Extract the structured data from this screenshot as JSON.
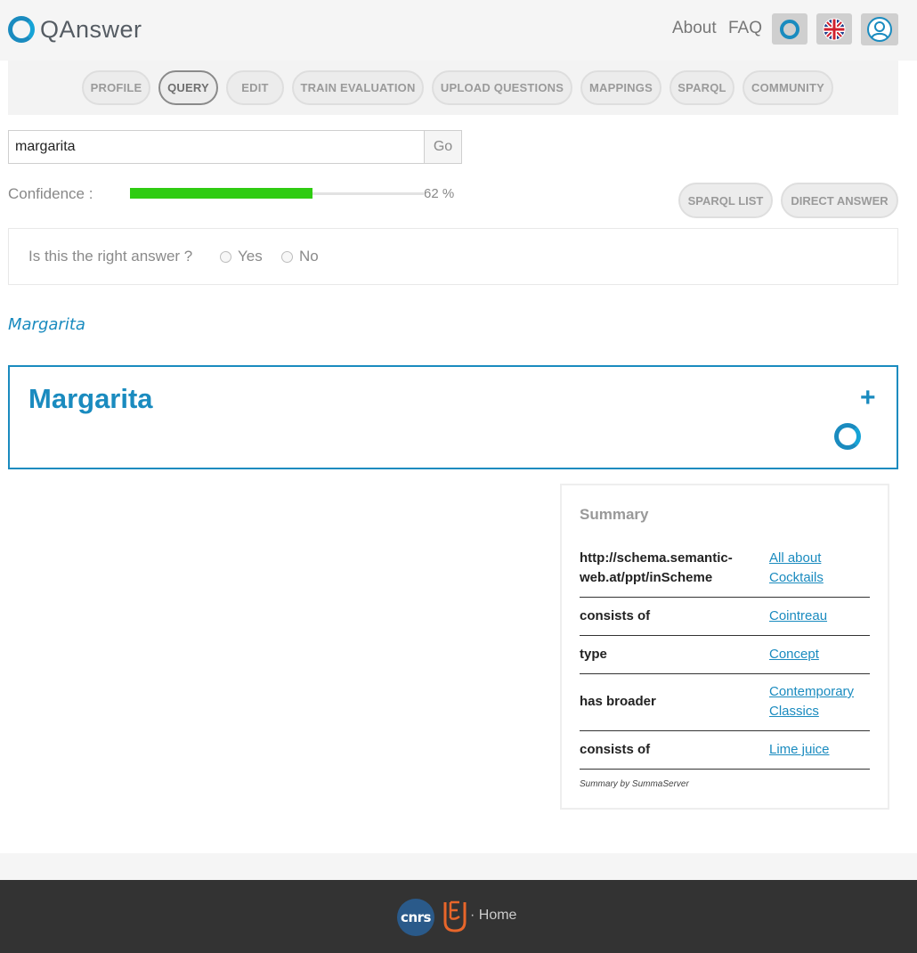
{
  "header": {
    "logo_text": "QAnswer",
    "about": "About",
    "faq": "FAQ"
  },
  "tabs": [
    {
      "label": "PROFILE"
    },
    {
      "label": "QUERY"
    },
    {
      "label": "EDIT"
    },
    {
      "label": "TRAIN EVALUATION"
    },
    {
      "label": "UPLOAD QUESTIONS"
    },
    {
      "label": "MAPPINGS"
    },
    {
      "label": "SPARQL"
    },
    {
      "label": "COMMUNITY"
    }
  ],
  "active_tab": "QUERY",
  "search": {
    "value": "margarita",
    "go_label": "Go"
  },
  "confidence": {
    "label": "Confidence :",
    "percent": 62,
    "value_text": "62 %"
  },
  "result_buttons": {
    "sparql_list": "SPARQL LIST",
    "direct_answer": "DIRECT ANSWER"
  },
  "feedback": {
    "question": "Is this the right answer ?",
    "yes": "Yes",
    "no": "No"
  },
  "answer": {
    "link": "Margarita",
    "title": "Margarita",
    "expand": "+"
  },
  "summary": {
    "title": "Summary",
    "rows": [
      {
        "key": "http://schema.semantic-web.at/ppt/inScheme",
        "value": "All about Cocktails"
      },
      {
        "key": "consists of",
        "value": "Cointreau"
      },
      {
        "key": "type",
        "value": "Concept"
      },
      {
        "key": "has broader",
        "value": "Contemporary Classics"
      },
      {
        "key": "consists of",
        "value": "Lime juice"
      }
    ],
    "credit": "Summary by SummaServer"
  },
  "footer": {
    "cnrs": "cnrs",
    "home": "· Home"
  },
  "colors": {
    "accent": "#1a8bbf",
    "confidence_bar": "#2fcc12",
    "footer_bg": "#333333"
  }
}
